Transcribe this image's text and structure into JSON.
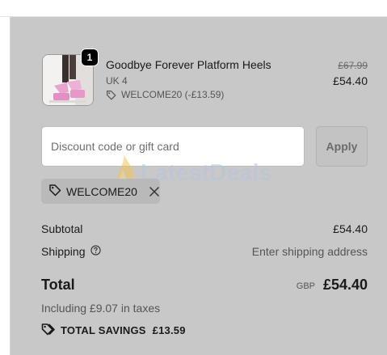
{
  "cart_item": {
    "quantity": "1",
    "title": "Goodbye Forever Platform Heels",
    "variant": "UK 4",
    "discount_applied": "WELCOME20 (-£13.59)",
    "original_price": "£67.99",
    "price": "£54.40",
    "image_icon": "pink-platform-heels-photo"
  },
  "discount": {
    "placeholder": "Discount code or gift card",
    "value": "",
    "apply_label": "Apply"
  },
  "applied_code": {
    "code": "WELCOME20",
    "tag_icon": "tag-icon",
    "remove_icon": "close-icon"
  },
  "watermark": {
    "text": "LatestDeals"
  },
  "summary": {
    "subtotal_label": "Subtotal",
    "subtotal_value": "£54.40",
    "shipping_label": "Shipping",
    "shipping_help_icon": "question-circle-icon",
    "shipping_value": "Enter shipping address",
    "total_label": "Total",
    "currency": "GBP",
    "total_value": "£54.40",
    "taxes_note": "Including £9.07 in taxes",
    "savings_label": "TOTAL SAVINGS",
    "savings_value": "£13.59"
  },
  "colors": {
    "panel_background": "#c8c8c8",
    "product_pink": "#e9a3cf"
  }
}
